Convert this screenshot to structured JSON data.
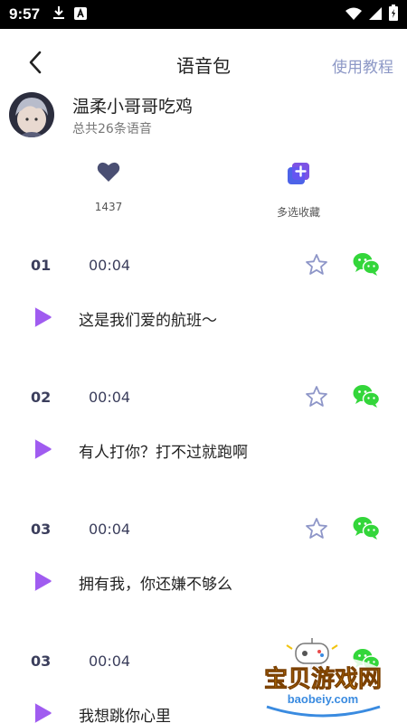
{
  "status_bar": {
    "time": "9:57"
  },
  "header": {
    "title": "语音包",
    "tutorial_link": "使用教程"
  },
  "profile": {
    "name": "温柔小哥哥吃鸡",
    "count_text": "总共26条语音"
  },
  "actions": {
    "like_count": "1437",
    "multi_select_label": "多选收藏"
  },
  "voices": [
    {
      "index": "01",
      "duration": "00:04",
      "text": "这是我们爱的航班～"
    },
    {
      "index": "02",
      "duration": "00:04",
      "text": "有人打你？打不过就跑啊"
    },
    {
      "index": "03",
      "duration": "00:04",
      "text": "拥有我，你还嫌不够么"
    },
    {
      "index": "03",
      "duration": "00:04",
      "text": "我想跳你心里"
    }
  ],
  "watermark": {
    "title": "宝贝游戏网",
    "url": "baobeiy.com"
  },
  "colors": {
    "accent_purple": "#a05cf0",
    "star": "#8e96c8",
    "wechat_green": "#33d63a",
    "link": "#8d98c6"
  }
}
